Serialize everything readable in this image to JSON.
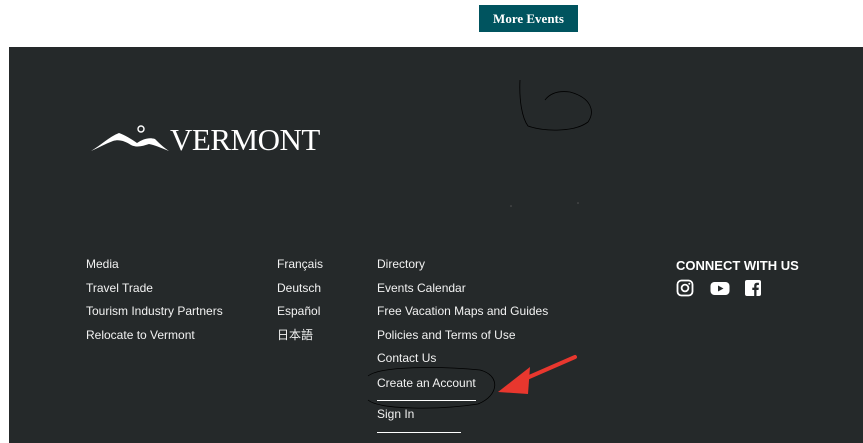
{
  "top": {
    "more_events_label": "More Events"
  },
  "logo": {
    "text": "VERMONT"
  },
  "footer": {
    "col1": [
      "Media",
      "Travel Trade",
      "Tourism Industry Partners",
      "Relocate to Vermont"
    ],
    "col2": [
      "Français",
      "Deutsch",
      "Español",
      "日本語"
    ],
    "col3": [
      "Directory",
      "Events Calendar",
      "Free Vacation Maps and Guides",
      "Policies and Terms of Use",
      "Contact Us",
      "Create an Account",
      "Sign In"
    ]
  },
  "connect": {
    "title": "CONNECT WITH US",
    "icons": [
      "instagram-icon",
      "youtube-icon",
      "facebook-icon"
    ]
  },
  "colors": {
    "footer_bg": "#25292a",
    "button_bg": "#00545f",
    "arrow": "#e8372e"
  }
}
